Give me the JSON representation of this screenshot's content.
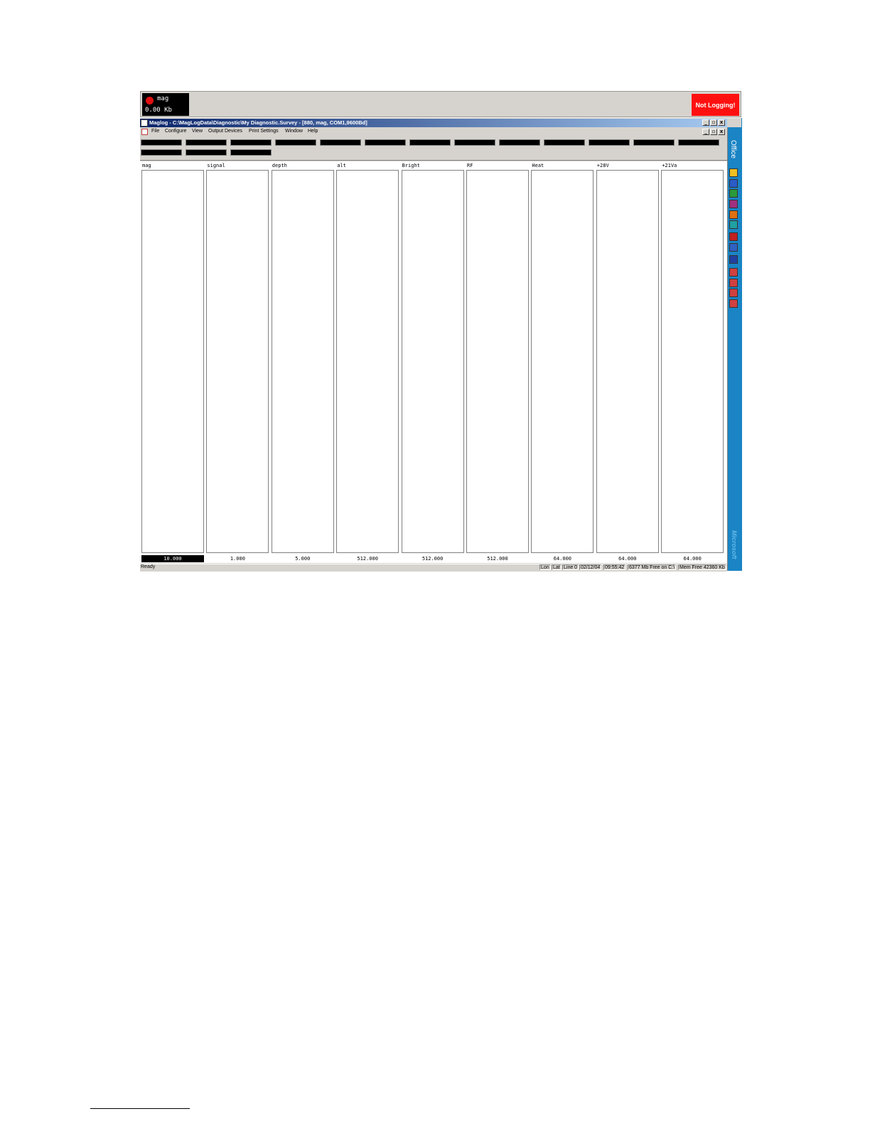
{
  "top_bar": {
    "channel": "mag",
    "data_size": "0.00 Kb",
    "logging_status": "Not Logging!"
  },
  "window": {
    "title": "Maglog - C:\\MagLogData\\Diagnostic\\My Diagnostic.Survey - [880, mag, COM1,9600Bd]",
    "controls": [
      "_",
      "▫",
      "x"
    ]
  },
  "menu": {
    "items": [
      "File",
      "Configure",
      "View",
      "Output Devices",
      "Print Settings",
      "Window",
      "Help"
    ]
  },
  "channels": [
    {
      "label": "mag",
      "scale": "10.000",
      "active": true
    },
    {
      "label": "signal",
      "scale": "1.000",
      "active": false
    },
    {
      "label": "depth",
      "scale": "5.000",
      "active": false
    },
    {
      "label": "alt",
      "scale": "512.000",
      "active": false
    },
    {
      "label": "Bright",
      "scale": "512.000",
      "active": false
    },
    {
      "label": "RF",
      "scale": "512.000",
      "active": false
    },
    {
      "label": "Heat",
      "scale": "64.000",
      "active": false
    },
    {
      "label": "+28V",
      "scale": "64.000",
      "active": false
    },
    {
      "label": "+21Va",
      "scale": "64.000",
      "active": false
    }
  ],
  "status_bar": {
    "ready": "Ready",
    "cells": [
      "Lon",
      "Lat",
      "Line 0",
      "02/12/04",
      "09:55:42",
      "6377 Mb Free on C:\\",
      "Mem Free 42360 Kb"
    ]
  },
  "office_bar": {
    "title": "Office",
    "brand": "Microsoft",
    "icon_colors": [
      "#f0c020",
      "#2a5bc8",
      "#2a9a3a",
      "#a03080",
      "#e07010",
      "#20a0a0",
      "#c02020",
      "#3060c0",
      "#2040a0",
      "#d04040",
      "#d04040",
      "#d04040",
      "#d04040"
    ]
  }
}
